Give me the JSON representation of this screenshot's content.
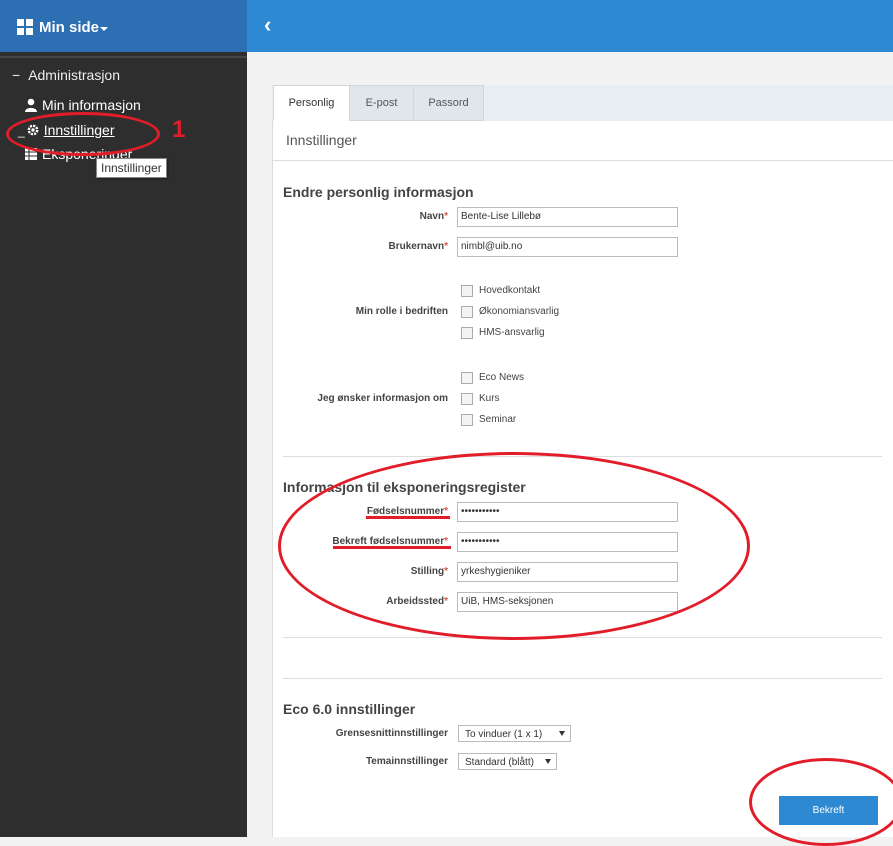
{
  "sidebar": {
    "title": "Min side",
    "section": "Administrasjon",
    "section_marker": "−",
    "items": [
      {
        "label": "Min informasjon",
        "icon": "user-icon"
      },
      {
        "label": "Innstillinger",
        "icon": "gear-icon"
      },
      {
        "label": "Eksponeringer",
        "icon": "table-icon"
      }
    ],
    "tooltip": "Innstillinger"
  },
  "annotation": {
    "number": "1",
    "color": "#e21d2a"
  },
  "colors": {
    "accent": "#2d8ad2",
    "sidebar_head": "#2d6fb3",
    "sidebar_bg": "#2e2e2e"
  },
  "tabs": [
    {
      "label": "Personlig",
      "active": true
    },
    {
      "label": "E-post",
      "active": false
    },
    {
      "label": "Passord",
      "active": false
    }
  ],
  "panel_title": "Innstillinger",
  "personal": {
    "title": "Endre personlig informasjon",
    "name_label": "Navn",
    "name_value": "Bente-Lise Lillebø",
    "username_label": "Brukernavn",
    "username_value": "nimbl@uib.no",
    "role_label": "Min rolle i bedriften",
    "roles": [
      "Hovedkontakt",
      "Økonomiansvarlig",
      "HMS-ansvarlig"
    ],
    "info_label": "Jeg ønsker informasjon om",
    "info_options": [
      "Eco News",
      "Kurs",
      "Seminar"
    ]
  },
  "exposure": {
    "title": "Informasjon til eksponeringsregister",
    "birth_label": "Fødselsnummer",
    "birth_value": "•••••••••••",
    "confirm_label": "Bekreft fødselsnummer",
    "confirm_value": "•••••••••••",
    "position_label": "Stilling",
    "position_value": "yrkeshygieniker",
    "workplace_label": "Arbeidssted",
    "workplace_value": "UiB, HMS-seksjonen"
  },
  "eco": {
    "title": "Eco 6.0 innstillinger",
    "interface_label": "Grensesnittinnstillinger",
    "interface_value": "To vinduer (1 x 1)",
    "theme_label": "Temainnstillinger",
    "theme_value": "Standard (blått)"
  },
  "submit_label": "Bekreft",
  "required_marker": "*"
}
